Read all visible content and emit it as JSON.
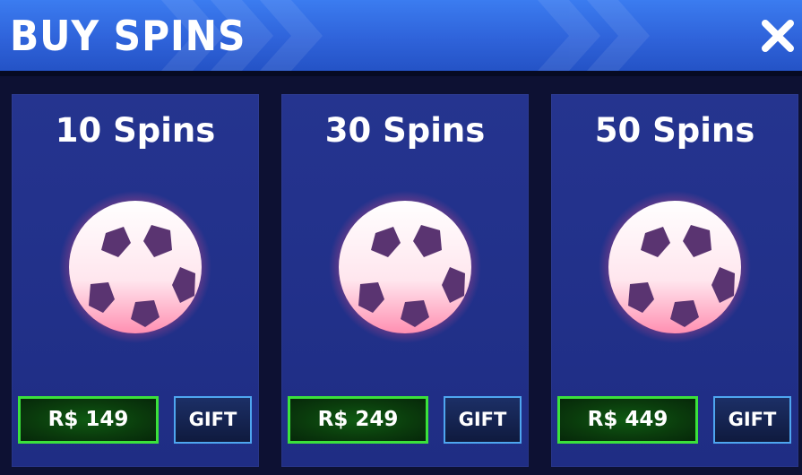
{
  "header": {
    "title": "BUY SPINS",
    "close_icon": "close-icon"
  },
  "colors": {
    "header_blue": "#2f63da",
    "card_blue": "#233291",
    "price_green": "#3be23b",
    "gift_border": "#4ea6f0",
    "ball_glow": "#ff5f8f"
  },
  "offers": [
    {
      "title": "10 Spins",
      "price": "R$ 149",
      "gift_label": "GIFT",
      "icon": "soccer-ball-icon"
    },
    {
      "title": "30 Spins",
      "price": "R$ 249",
      "gift_label": "GIFT",
      "icon": "soccer-ball-icon"
    },
    {
      "title": "50 Spins",
      "price": "R$ 449",
      "gift_label": "GIFT",
      "icon": "soccer-ball-icon"
    }
  ]
}
